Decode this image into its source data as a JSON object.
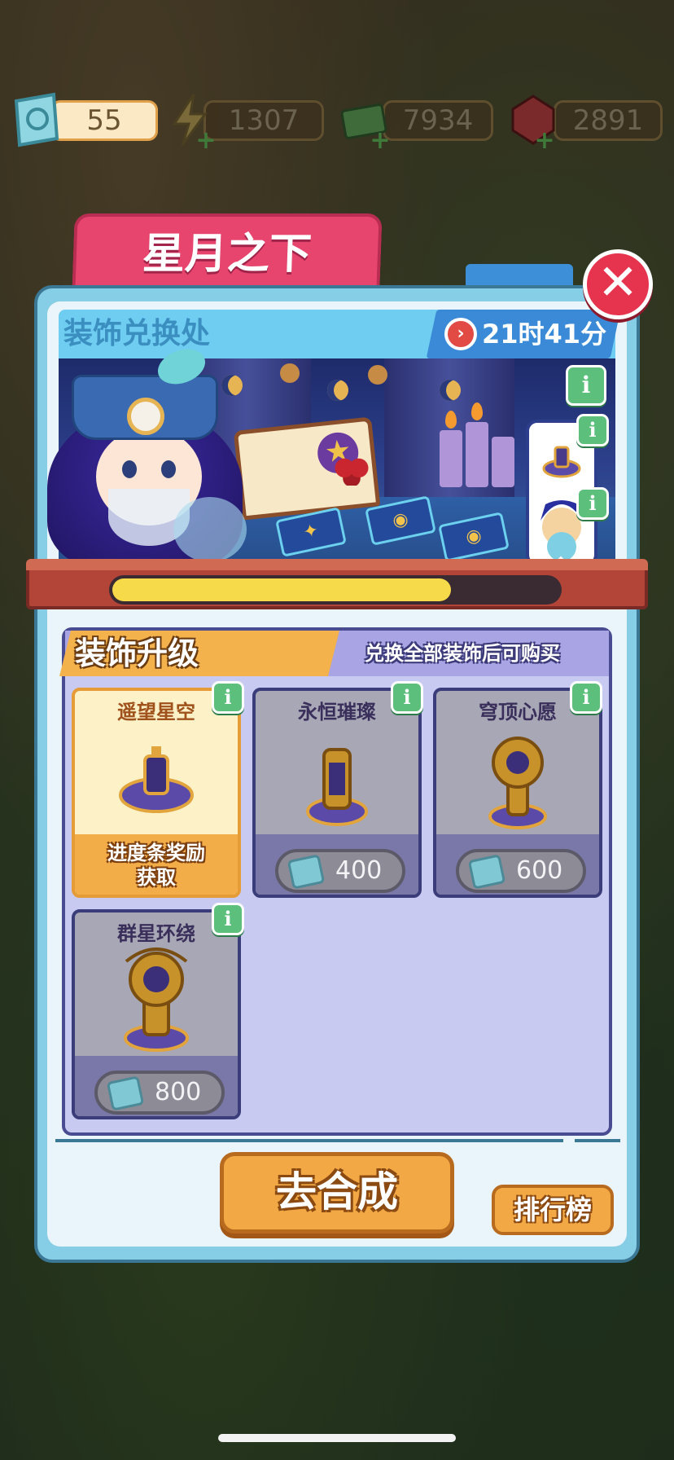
{
  "currencies": [
    {
      "name": "ticket",
      "value": "55",
      "active": true
    },
    {
      "name": "energy",
      "value": "1307",
      "active": false
    },
    {
      "name": "cash",
      "value": "7934",
      "active": false
    },
    {
      "name": "gem",
      "value": "2891",
      "active": false
    }
  ],
  "event": {
    "title": "星月之下",
    "shop_title": "装饰兑换处",
    "timer": "21时41分",
    "progress_fraction": 0.76
  },
  "upgrade": {
    "title": "装饰升级",
    "note": "兑换全部装饰后可购买",
    "items": [
      {
        "name": "遥望星空",
        "reward_line1": "进度条奖励",
        "reward_line2": "获取"
      },
      {
        "name": "永恒璀璨",
        "price": "400"
      },
      {
        "name": "穹顶心愿",
        "price": "600"
      },
      {
        "name": "群星环绕",
        "price": "800"
      }
    ]
  },
  "buttons": {
    "synthesize": "去合成",
    "leaderboard": "排行榜",
    "close_symbol": "✕",
    "info_symbol": "i"
  },
  "colors": {
    "title_tab": "#e8456e",
    "progress": "#f6da4a",
    "button": "#f2a844"
  }
}
